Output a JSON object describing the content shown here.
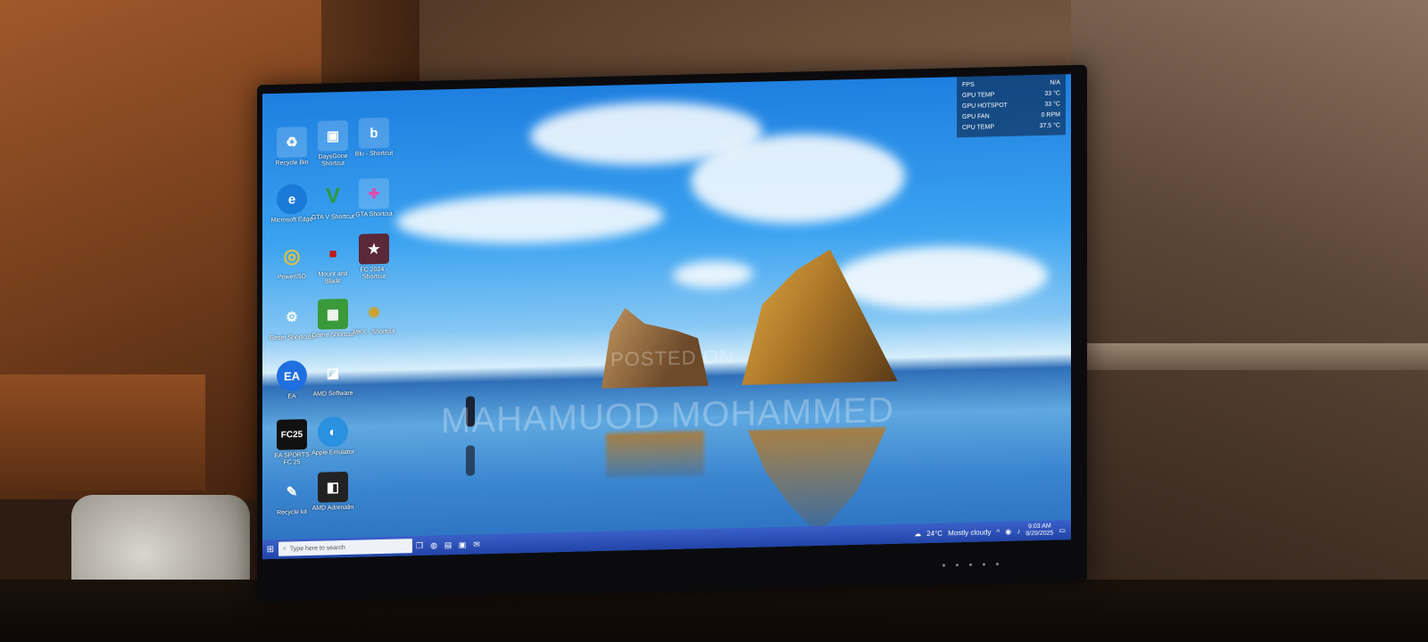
{
  "desktop": {
    "icons": [
      {
        "label": "Recycle Bin",
        "glyph": "♻"
      },
      {
        "label": "DaysGone Shortcut",
        "glyph": "▣"
      },
      {
        "label": "Blu - Shortcut",
        "glyph": "b"
      },
      {
        "label": "Microsoft Edge",
        "glyph": "e"
      },
      {
        "label": "GTA V Shortcut",
        "glyph": "V"
      },
      {
        "label": "GTA Shortcut",
        "glyph": "✚"
      },
      {
        "label": "PowerISO",
        "glyph": "◎"
      },
      {
        "label": "Mount and Blade",
        "glyph": "■"
      },
      {
        "label": "FC 2024 - Shortcut",
        "glyph": "★"
      },
      {
        "label": "Reset Shortcuts",
        "glyph": "⚙"
      },
      {
        "label": "Game Shortcut",
        "glyph": "▦"
      },
      {
        "label": "MKX - Shortcut",
        "glyph": "◉"
      },
      {
        "label": "EA",
        "glyph": "EA"
      },
      {
        "label": "AMD Software",
        "glyph": "◪"
      },
      {
        "label": "EA SPORTS FC 25",
        "glyph": "FC25"
      },
      {
        "label": "Apple Emulator",
        "glyph": "◐"
      },
      {
        "label": "Recycle kit",
        "glyph": "✎"
      },
      {
        "label": "AMD Adrenalin",
        "glyph": "◧"
      }
    ]
  },
  "overlay": {
    "rows": [
      {
        "label": "FPS",
        "value": "N/A"
      },
      {
        "label": "GPU TEMP",
        "value": "33 °C"
      },
      {
        "label": "GPU HOTSPOT",
        "value": "33 °C"
      },
      {
        "label": "GPU FAN",
        "value": "0 RPM"
      },
      {
        "label": "CPU TEMP",
        "value": "37.5 °C"
      }
    ]
  },
  "watermark": {
    "line1": "POSTED ON",
    "line2": "MAHAMUOD MOHAMMED"
  },
  "taskbar": {
    "start_glyph": "⊞",
    "search_placeholder": "Type here to search",
    "weather_temp": "24°C",
    "weather_text": "Mostly cloudy",
    "time": "9:03 AM",
    "date": "8/29/2025"
  },
  "colors": {
    "taskbar": "#2244a8",
    "sky": "#1e7fe0"
  }
}
